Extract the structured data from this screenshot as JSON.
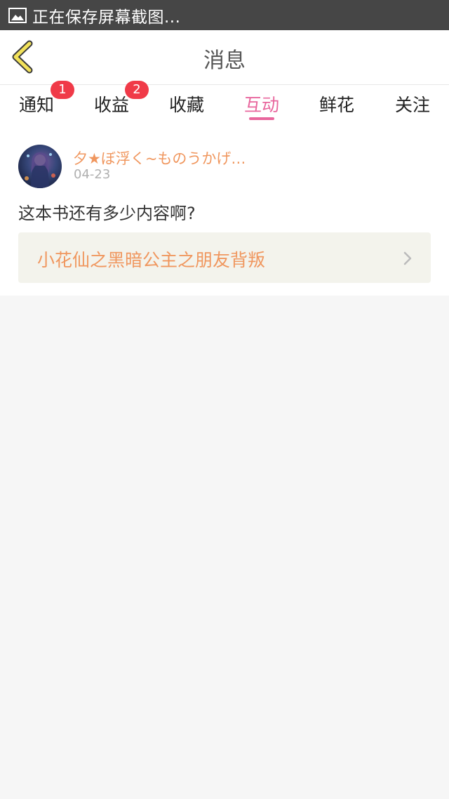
{
  "status_bar": {
    "text": "正在保存屏幕截图..."
  },
  "header": {
    "title": "消息"
  },
  "tabs": [
    {
      "label": "通知",
      "badge": "1",
      "active": false
    },
    {
      "label": "收益",
      "badge": "2",
      "active": false
    },
    {
      "label": "收藏",
      "active": false
    },
    {
      "label": "互动",
      "active": true
    },
    {
      "label": "鲜花",
      "active": false
    },
    {
      "label": "关注",
      "active": false
    }
  ],
  "message": {
    "username": "夕★ぼ浮く~ものうかげ…",
    "date": "04-23",
    "comment": "这本书还有多少内容啊?",
    "book_title": "小花仙之黑暗公主之朋友背叛"
  },
  "colors": {
    "accent": "#e8669d",
    "badge": "#f03a48",
    "link_orange": "#f0975f",
    "back_arrow": "#f2e25a"
  }
}
